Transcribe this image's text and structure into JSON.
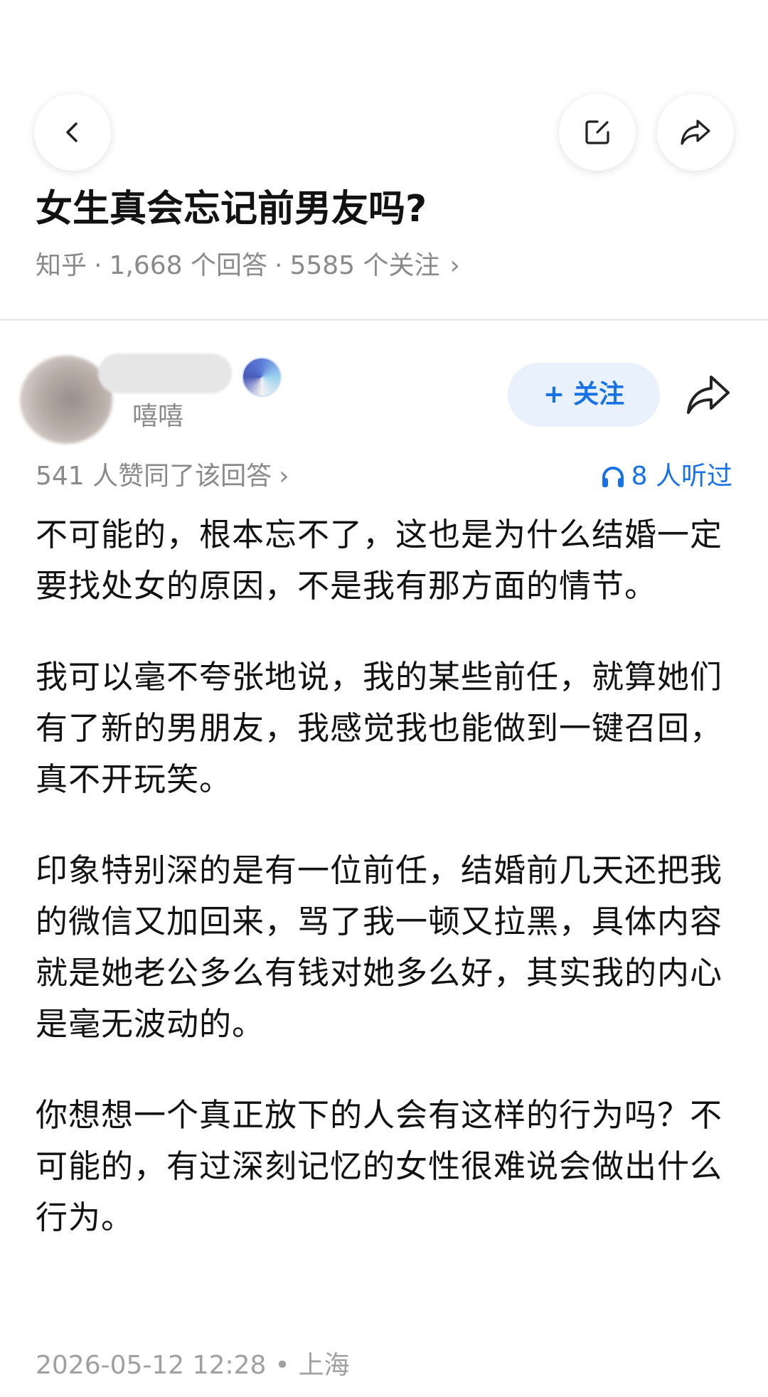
{
  "nav": {
    "back_icon": "chevron-left-icon",
    "edit_icon": "edit-square-icon",
    "share_icon": "share-arrow-icon"
  },
  "question": {
    "title": "女生真会忘记前男友吗?",
    "source": "知乎",
    "sep": "·",
    "answers": "1,668 个回答",
    "followers": "5585 个关注",
    "chevron": "›"
  },
  "author": {
    "subtitle": "嘻嘻",
    "follow_plus": "+",
    "follow_label": "关注"
  },
  "stats": {
    "agree": "541 人赞同了该回答",
    "agree_chevron": "›",
    "listen": "8 人听过",
    "accent": "#1772e8"
  },
  "answer": {
    "paragraphs": [
      "不可能的，根本忘不了，这也是为什么结婚一定要找处女的原因，不是我有那方面的情节。",
      "我可以毫不夸张地说，我的某些前任，就算她们有了新的男朋友，我感觉我也能做到一键召回，真不开玩笑。",
      "印象特别深的是有一位前任，结婚前几天还把我的微信又加回来，骂了我一顿又拉黑，具体内容就是她老公多么有钱对她多么好，其实我的内心是毫无波动的。",
      "你想想一个真正放下的人会有这样的行为吗？不可能的，有过深刻记忆的女性很难说会做出什么行为。"
    ]
  },
  "footer": {
    "datetime": "2026-05-12 12:28",
    "dot": "•",
    "location": "上海"
  }
}
